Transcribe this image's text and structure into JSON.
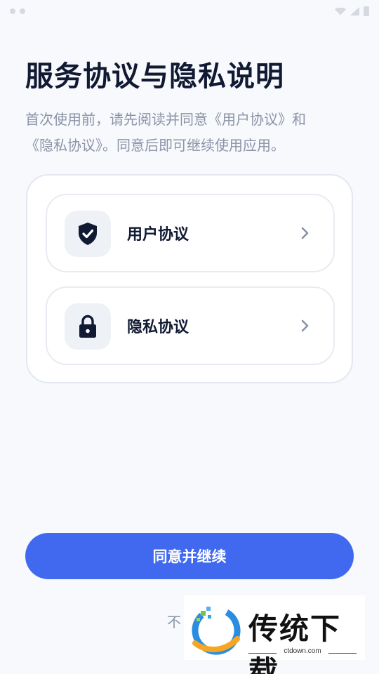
{
  "title": "服务协议与隐私说明",
  "description_line1": "首次使用前，请先阅读并同意《用户协议》和",
  "description_line2": "《隐私协议》。同意后即可继续使用应用。",
  "agreements": [
    {
      "label": "用户协议",
      "icon": "shield-check-icon"
    },
    {
      "label": "隐私协议",
      "icon": "lock-icon"
    }
  ],
  "primary_button": "同意并继续",
  "secondary_link": "不",
  "watermark": {
    "text": "传统下载",
    "url": "ctdown.com"
  },
  "colors": {
    "accent": "#4169f0",
    "title": "#111a33",
    "muted": "#8a93a6",
    "background": "#f8f9fd"
  }
}
